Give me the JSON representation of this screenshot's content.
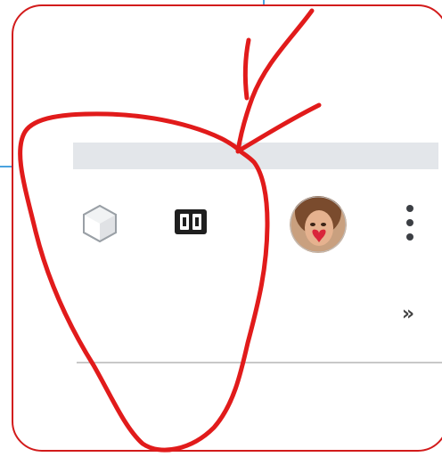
{
  "toolbar": {
    "extensions": [
      {
        "name": "hexagon-extension",
        "icon": "hexagon-icon"
      },
      {
        "name": "reader-extension",
        "icon": "immersive-reader-icon"
      }
    ],
    "profile": {
      "icon": "profile-avatar"
    },
    "menu": {
      "icon": "vertical-ellipsis-icon"
    }
  },
  "bookmarks_bar": {
    "overflow_chevron": "»"
  },
  "annotation": {
    "color": "#d21b1b",
    "frame_color": "#d21b1b"
  }
}
